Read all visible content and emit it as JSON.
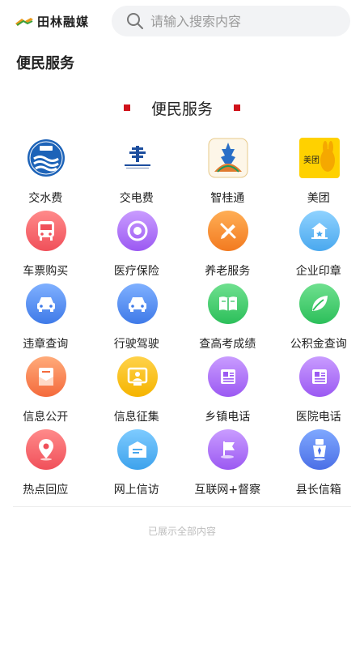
{
  "app": {
    "logo_text": "田林融媒"
  },
  "search": {
    "placeholder": "请输入搜索内容"
  },
  "page": {
    "title": "便民服务"
  },
  "section": {
    "title": "便民服务"
  },
  "services": [
    {
      "label": "交水费",
      "icon": "water-bill-icon"
    },
    {
      "label": "交电费",
      "icon": "electricity-bill-icon"
    },
    {
      "label": "智桂通",
      "icon": "zhiguitong-icon"
    },
    {
      "label": "美团",
      "icon": "meituan-icon",
      "icon_text": "美团"
    },
    {
      "label": "车票购买",
      "icon": "bus-icon"
    },
    {
      "label": "医疗保险",
      "icon": "medical-insurance-icon"
    },
    {
      "label": "养老服务",
      "icon": "pension-icon"
    },
    {
      "label": "企业印章",
      "icon": "company-seal-icon"
    },
    {
      "label": "违章查询",
      "icon": "car-violation-icon"
    },
    {
      "label": "行驶驾驶",
      "icon": "car-license-icon"
    },
    {
      "label": "查高考成绩",
      "icon": "exam-book-icon"
    },
    {
      "label": "公积金查询",
      "icon": "housing-fund-icon"
    },
    {
      "label": "信息公开",
      "icon": "info-disclosure-icon"
    },
    {
      "label": "信息征集",
      "icon": "info-collection-icon"
    },
    {
      "label": "乡镇电话",
      "icon": "township-phone-icon"
    },
    {
      "label": "医院电话",
      "icon": "hospital-phone-icon"
    },
    {
      "label": "热点回应",
      "icon": "location-pin-icon"
    },
    {
      "label": "网上信访",
      "icon": "online-petition-icon"
    },
    {
      "label": "互联网+督察",
      "icon": "flag-inspection-icon"
    },
    {
      "label": "县长信箱",
      "icon": "mayor-mailbox-icon"
    }
  ],
  "footer": {
    "note": "已展示全部内容"
  },
  "colors": {
    "accent_red": "#d0121b"
  }
}
